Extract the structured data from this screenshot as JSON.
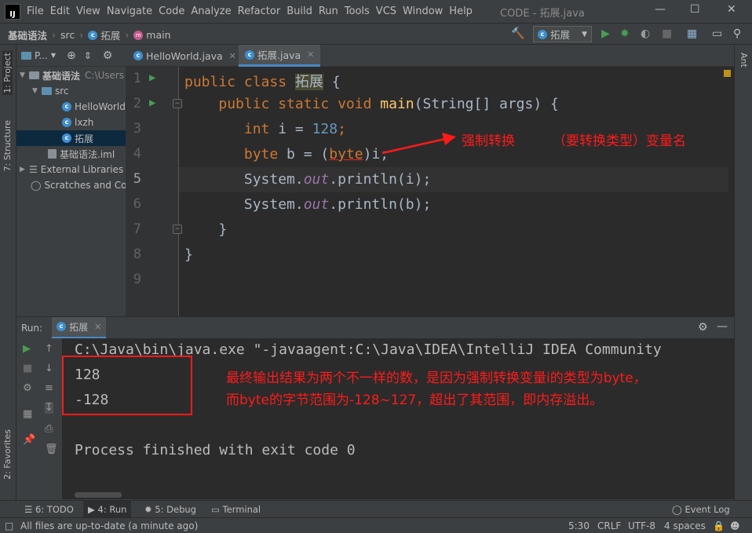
{
  "window": {
    "title": "CODE - 拓展.java",
    "logo": "IJ"
  },
  "menu": [
    "File",
    "Edit",
    "View",
    "Navigate",
    "Code",
    "Analyze",
    "Refactor",
    "Build",
    "Run",
    "Tools",
    "VCS",
    "Window",
    "Help"
  ],
  "breadcrumb": [
    "基础语法",
    "src",
    "拓展",
    "main"
  ],
  "run_config": "拓展",
  "left_tabs": {
    "project": "1: Project",
    "structure": "7: Structure",
    "favorites": "2: Favorites"
  },
  "right_tabs": {
    "ant": "Ant"
  },
  "project": {
    "header": "P...",
    "tree": [
      {
        "label": "基础语法",
        "extra": "C:\\Users"
      },
      {
        "label": "src"
      },
      {
        "label": "HelloWorld"
      },
      {
        "label": "lxzh"
      },
      {
        "label": "拓展"
      },
      {
        "label": "基础语法.iml"
      },
      {
        "label": "External Libraries"
      },
      {
        "label": "Scratches and Co"
      }
    ]
  },
  "editor": {
    "tabs": [
      {
        "label": "HelloWorld.java",
        "active": false
      },
      {
        "label": "拓展.java",
        "active": true
      }
    ],
    "line_numbers": [
      "1",
      "2",
      "3",
      "4",
      "5",
      "6",
      "7",
      "8",
      "9"
    ],
    "code": {
      "l1_kw": "public class",
      "l1_name": "拓展",
      "l1_rest": " {",
      "l2_kw": "public static void",
      "l2_fn": "main",
      "l2_rest": "(String[] args) {",
      "l3_kw": "int",
      "l3_mid": " i = ",
      "l3_num": "128",
      "l3_end": ";",
      "l4_kw": "byte",
      "l4_mid": " b = (",
      "l4_cast": "byte",
      "l4_end": ")i;",
      "l5_a": "System.",
      "l5_field": "out",
      "l5_b": ".println(i);",
      "l6_a": "System.",
      "l6_field": "out",
      "l6_b": ".println(b);",
      "l7": "}",
      "l8": "}"
    },
    "annotation": {
      "label": "强制转换",
      "hint": "（要转换类型）变量名"
    }
  },
  "run_panel": {
    "label": "Run:",
    "tab": "拓展",
    "command": "C:\\Java\\bin\\java.exe \"-javaagent:C:\\Java\\IDEA\\IntelliJ IDEA Community",
    "output": [
      "128",
      "-128"
    ],
    "finished": "Process finished with exit code 0",
    "note_line1": "最终输出结果为两个不一样的数，是因为强制转换变量i的类型为byte，",
    "note_line2": "而byte的字节范围为-128~127，超出了其范围，即内存溢出。"
  },
  "bottom_tabs": {
    "todo": "6: TODO",
    "run": "4: Run",
    "debug": "5: Debug",
    "terminal": "Terminal",
    "event_log": "Event Log"
  },
  "status": {
    "message": "All files are up-to-date (a minute ago)",
    "position": "5:30",
    "line_sep": "CRLF",
    "encoding": "UTF-8",
    "indent": "4 spaces"
  },
  "colors": {
    "annotation": "#ff1a1a",
    "keyword": "#cc7832",
    "number": "#6897bb",
    "function": "#ffc66d"
  }
}
